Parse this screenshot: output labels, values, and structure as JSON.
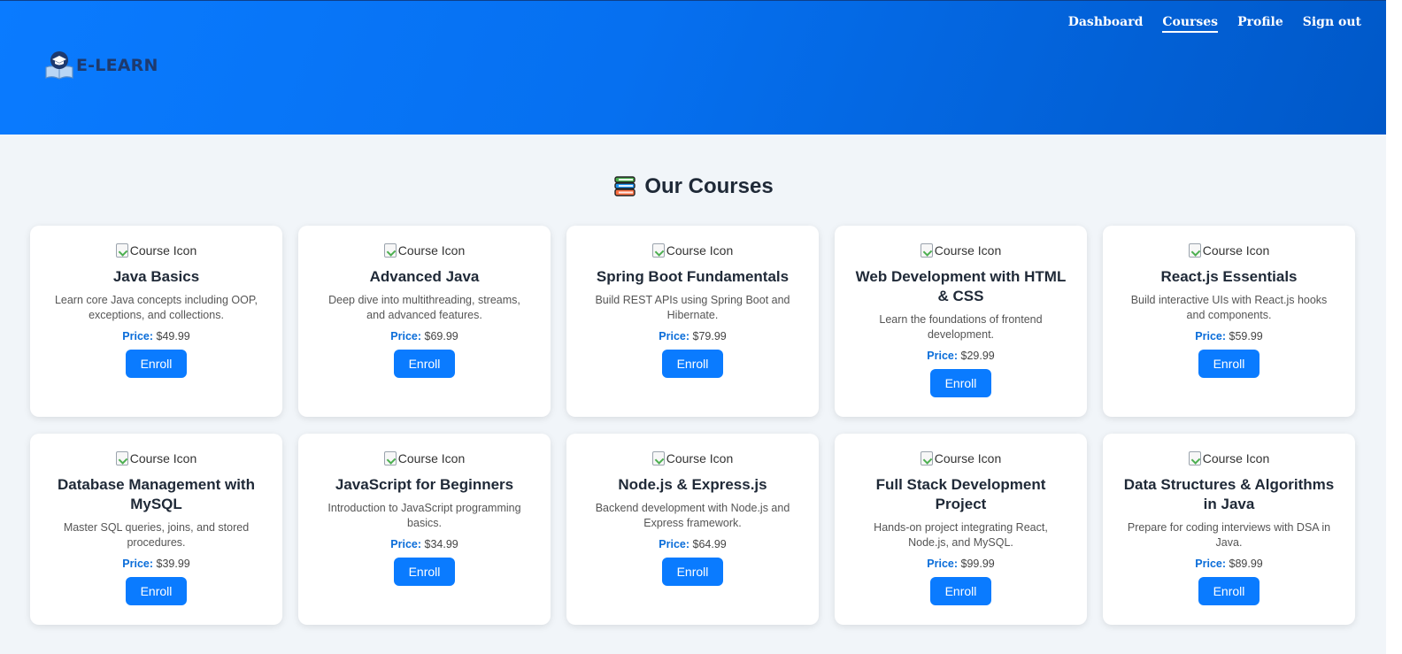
{
  "nav": {
    "logo_text": "E-LEARN",
    "links": [
      {
        "label": "Dashboard",
        "active": false
      },
      {
        "label": "Courses",
        "active": true
      },
      {
        "label": "Profile",
        "active": false
      },
      {
        "label": "Sign out",
        "active": false
      }
    ]
  },
  "page": {
    "heading": "Our Courses",
    "heading_icon": "books-icon"
  },
  "common": {
    "image_alt": "Course Icon",
    "price_label": "Price:",
    "enroll_label": "Enroll"
  },
  "courses": [
    {
      "title": "Java Basics",
      "description": "Learn core Java concepts including OOP, exceptions, and collections.",
      "price": "$49.99"
    },
    {
      "title": "Advanced Java",
      "description": "Deep dive into multithreading, streams, and advanced features.",
      "price": "$69.99"
    },
    {
      "title": "Spring Boot Fundamentals",
      "description": "Build REST APIs using Spring Boot and Hibernate.",
      "price": "$79.99"
    },
    {
      "title": "Web Development with HTML & CSS",
      "description": "Learn the foundations of frontend development.",
      "price": "$29.99"
    },
    {
      "title": "React.js Essentials",
      "description": "Build interactive UIs with React.js hooks and components.",
      "price": "$59.99"
    },
    {
      "title": "Database Management with MySQL",
      "description": "Master SQL queries, joins, and stored procedures.",
      "price": "$39.99"
    },
    {
      "title": "JavaScript for Beginners",
      "description": "Introduction to JavaScript programming basics.",
      "price": "$34.99"
    },
    {
      "title": "Node.js & Express.js",
      "description": "Backend development with Node.js and Express framework.",
      "price": "$64.99"
    },
    {
      "title": "Full Stack Development Project",
      "description": "Hands-on project integrating React, Node.js, and MySQL.",
      "price": "$99.99"
    },
    {
      "title": "Data Structures & Algorithms in Java",
      "description": "Prepare for coding interviews with DSA in Java.",
      "price": "$89.99"
    }
  ],
  "colors": {
    "header_gradient_start": "#0a7bff",
    "header_gradient_end": "#0058c8",
    "accent": "#0a7bff",
    "background": "#f1f5f9"
  }
}
